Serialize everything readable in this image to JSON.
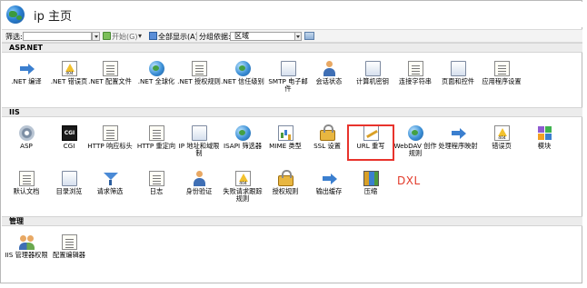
{
  "header": {
    "title": "ip 主页"
  },
  "toolbar": {
    "filter_label": "筛选:",
    "filter_value": "",
    "go_label": "开始(G)",
    "show_all_label": "全部显示(A)",
    "group_by_label": "分组依据:",
    "group_by_value": "区域"
  },
  "sections": [
    {
      "title": "ASP.NET",
      "items": [
        {
          "label": ".NET 编译",
          "icon": "compile-icon"
        },
        {
          "label": ".NET 错误页",
          "icon": "error-page-icon"
        },
        {
          "label": ".NET 配置文件",
          "icon": "config-icon"
        },
        {
          "label": ".NET 全球化",
          "icon": "globalization-icon"
        },
        {
          "label": ".NET 授权规则",
          "icon": "authorization-icon"
        },
        {
          "label": ".NET 信任级别",
          "icon": "trust-icon"
        },
        {
          "label": "SMTP 电子邮件",
          "icon": "smtp-icon"
        },
        {
          "label": "会话状态",
          "icon": "session-icon"
        },
        {
          "label": "计算机密钥",
          "icon": "machine-key-icon"
        },
        {
          "label": "连接字符串",
          "icon": "connection-string-icon"
        },
        {
          "label": "页面和控件",
          "icon": "pages-controls-icon"
        },
        {
          "label": "应用程序设置",
          "icon": "app-settings-icon"
        }
      ]
    },
    {
      "title": "IIS",
      "items": [
        {
          "label": "ASP",
          "icon": "asp-icon"
        },
        {
          "label": "CGI",
          "icon": "cgi-icon"
        },
        {
          "label": "HTTP 响应标头",
          "icon": "http-headers-icon"
        },
        {
          "label": "HTTP 重定向",
          "icon": "http-redirect-icon"
        },
        {
          "label": "IP 地址和域限制",
          "icon": "ip-restrict-icon"
        },
        {
          "label": "ISAPI 筛选器",
          "icon": "isapi-filter-icon"
        },
        {
          "label": "MIME 类型",
          "icon": "mime-icon"
        },
        {
          "label": "SSL 设置",
          "icon": "ssl-lock-icon"
        },
        {
          "label": "URL 重写",
          "icon": "url-rewrite-icon"
        },
        {
          "label": "WebDAV 创作规则",
          "icon": "webdav-icon"
        },
        {
          "label": "处理程序映射",
          "icon": "handler-icon"
        },
        {
          "label": "错误页",
          "icon": "error-pages-icon"
        },
        {
          "label": "模块",
          "icon": "modules-icon"
        },
        {
          "label": "默认文档",
          "icon": "default-doc-icon"
        },
        {
          "label": "目录浏览",
          "icon": "dir-browse-icon"
        },
        {
          "label": "请求筛选",
          "icon": "request-filter-icon"
        },
        {
          "label": "日志",
          "icon": "logging-icon"
        },
        {
          "label": "身份验证",
          "icon": "authentication-icon"
        },
        {
          "label": "失败请求跟踪规则",
          "icon": "failed-request-icon"
        },
        {
          "label": "授权规则",
          "icon": "authz-rules-icon"
        },
        {
          "label": "输出缓存",
          "icon": "output-cache-icon"
        },
        {
          "label": "压缩",
          "icon": "compression-icon"
        }
      ]
    },
    {
      "title": "管理",
      "items": [
        {
          "label": "IIS 管理器权限",
          "icon": "iis-manager-perms-icon"
        },
        {
          "label": "配置编辑器",
          "icon": "config-editor-icon"
        }
      ]
    }
  ],
  "annotation": {
    "text": "DXL",
    "color": "#e23a2a"
  },
  "colors": {
    "highlight": "#e8332c",
    "section_bg": "#ececec"
  }
}
